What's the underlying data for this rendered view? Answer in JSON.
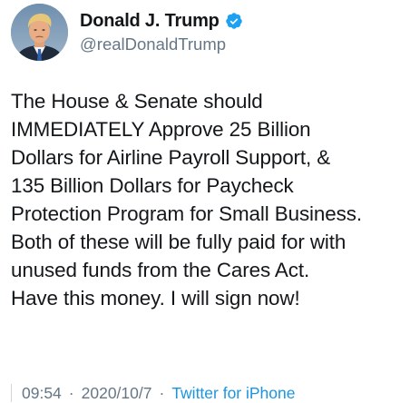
{
  "author": {
    "display_name": "Donald J. Trump",
    "handle": "@realDonaldTrump",
    "verified": true,
    "avatar_icon": "profile-photo",
    "verified_icon": "verified-badge-icon",
    "verified_color": "#1da1f2"
  },
  "tweet": {
    "lines": [
      "The House & Senate should",
      "IMMEDIATELY Approve 25 Billion",
      "Dollars for Airline Payroll Support, &",
      "135 Billion Dollars for Paycheck",
      "Protection Program for Small Business.",
      "Both of these will be fully paid for with",
      "unused funds from the Cares Act.",
      "Have this money. I will sign now!"
    ]
  },
  "meta": {
    "time": "09:54",
    "separator": "·",
    "date": "2020/10/7",
    "source": "Twitter for iPhone",
    "link_color": "#1b95e0"
  }
}
